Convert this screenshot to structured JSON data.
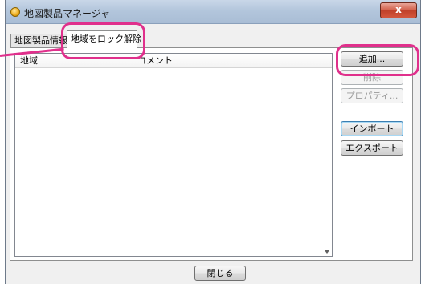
{
  "window": {
    "title": "地図製品マネージャ",
    "close_label": "x"
  },
  "tabs": [
    {
      "label": "地図製品情報",
      "active": false
    },
    {
      "label": "地域をロック解除",
      "active": true
    }
  ],
  "list": {
    "columns": [
      "地域",
      "コメント"
    ],
    "rows": []
  },
  "buttons": {
    "add": "追加...",
    "delete": "削除",
    "properties": "プロパティ...",
    "import": "インポート",
    "export": "エクスポート",
    "close": "閉じる"
  },
  "annotation": {
    "color": "#e0308c"
  }
}
